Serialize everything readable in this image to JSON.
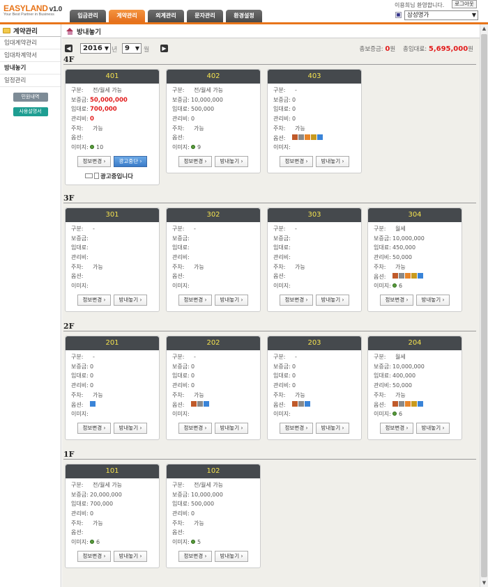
{
  "app": {
    "logo": "EASYLAND",
    "version": "v1.0",
    "tagline": "Your Best Partner in Business"
  },
  "nav": {
    "tabs": [
      {
        "label": "입금관리",
        "active": false
      },
      {
        "label": "계약관리",
        "active": true
      },
      {
        "label": "외계관리",
        "active": false
      },
      {
        "label": "문자관리",
        "active": false
      },
      {
        "label": "환경설정",
        "active": false
      }
    ]
  },
  "user": {
    "welcome": "이용희님 환영합니다.",
    "logout_label": "로그아웃",
    "company": "삼성명가"
  },
  "sidebar": {
    "title": "계약관리",
    "items": [
      {
        "label": "임대계약관리",
        "active": false
      },
      {
        "label": "임대차계약서",
        "active": false
      },
      {
        "label": "방내놓기",
        "active": true
      },
      {
        "label": "일정관리",
        "active": false
      }
    ],
    "buttons": [
      {
        "label": "민원내역",
        "color": "#7d8b96"
      },
      {
        "label": "사용설명서",
        "color": "#1e9e92"
      }
    ]
  },
  "page": {
    "title": "방내놓기",
    "year": "2016",
    "year_unit": "년",
    "month": "9",
    "month_unit": "월",
    "totals": {
      "deposit_label": "총보증금:",
      "deposit_value": "0",
      "deposit_unit": "원",
      "rent_label": "총임대료:",
      "rent_value": "5,695,000",
      "rent_unit": "원"
    }
  },
  "labels": {
    "type": "구분:",
    "deposit": "보증금:",
    "rent": "임대료:",
    "fee": "관리비:",
    "parking": "주차:",
    "options": "옵션:",
    "images": "이미지:",
    "edit_button": "정보변경",
    "list_button": "방내놓기",
    "ad_stop_button": "광고중단",
    "ad_status": "광고중입니다"
  },
  "floors": [
    {
      "label": "4F",
      "rooms": [
        {
          "number": "401",
          "type": "전/월세 가능",
          "deposit": "50,000,000",
          "rent": "700,000",
          "fee": "0",
          "parking": "가능",
          "options": "",
          "option_icons": [],
          "images": "10",
          "highlight": true,
          "advertised": true
        },
        {
          "number": "402",
          "type": "전/월세 가능",
          "deposit": "10,000,000",
          "rent": "500,000",
          "fee": "0",
          "parking": "가능",
          "options": "",
          "option_icons": [],
          "images": "9",
          "highlight": false,
          "advertised": false
        },
        {
          "number": "403",
          "type": "-",
          "deposit": "0",
          "rent": "0",
          "fee": "0",
          "parking": "가능",
          "options": "",
          "option_icons": [
            "a",
            "b",
            "c",
            "d",
            "e"
          ],
          "images": "",
          "highlight": false,
          "advertised": false
        }
      ]
    },
    {
      "label": "3F",
      "rooms": [
        {
          "number": "301",
          "type": "-",
          "deposit": "",
          "rent": "",
          "fee": "",
          "parking": "가능",
          "options": "",
          "option_icons": [],
          "images": "",
          "highlight": false,
          "advertised": false
        },
        {
          "number": "302",
          "type": "-",
          "deposit": "",
          "rent": "",
          "fee": "",
          "parking": "가능",
          "options": "",
          "option_icons": [],
          "images": "",
          "highlight": false,
          "advertised": false
        },
        {
          "number": "303",
          "type": "-",
          "deposit": "",
          "rent": "",
          "fee": "",
          "parking": "가능",
          "options": "",
          "option_icons": [],
          "images": "",
          "highlight": false,
          "advertised": false
        },
        {
          "number": "304",
          "type": "월세",
          "deposit": "10,000,000",
          "rent": "450,000",
          "fee": "50,000",
          "parking": "가능",
          "options": "",
          "option_icons": [
            "a",
            "b",
            "c",
            "d",
            "e"
          ],
          "images": "6",
          "highlight": false,
          "advertised": false
        }
      ]
    },
    {
      "label": "2F",
      "rooms": [
        {
          "number": "201",
          "type": "-",
          "deposit": "0",
          "rent": "0",
          "fee": "0",
          "parking": "가능",
          "options": "",
          "option_icons": [
            "e"
          ],
          "images": "",
          "highlight": false,
          "advertised": false
        },
        {
          "number": "202",
          "type": "-",
          "deposit": "0",
          "rent": "0",
          "fee": "0",
          "parking": "가능",
          "options": "",
          "option_icons": [
            "a",
            "b",
            "e"
          ],
          "images": "",
          "highlight": false,
          "advertised": false
        },
        {
          "number": "203",
          "type": "-",
          "deposit": "0",
          "rent": "0",
          "fee": "0",
          "parking": "가능",
          "options": "",
          "option_icons": [
            "a",
            "b",
            "e"
          ],
          "images": "",
          "highlight": false,
          "advertised": false
        },
        {
          "number": "204",
          "type": "월세",
          "deposit": "10,000,000",
          "rent": "400,000",
          "fee": "50,000",
          "parking": "가능",
          "options": "",
          "option_icons": [
            "a",
            "b",
            "c",
            "d",
            "e"
          ],
          "images": "6",
          "highlight": false,
          "advertised": false
        }
      ]
    },
    {
      "label": "1F",
      "rooms": [
        {
          "number": "101",
          "type": "전/월세 가능",
          "deposit": "20,000,000",
          "rent": "700,000",
          "fee": "0",
          "parking": "가능",
          "options": "",
          "option_icons": [],
          "images": "6",
          "highlight": false,
          "advertised": false
        },
        {
          "number": "102",
          "type": "전/월세 가능",
          "deposit": "10,000,000",
          "rent": "500,000",
          "fee": "0",
          "parking": "가능",
          "options": "",
          "option_icons": [],
          "images": "5",
          "highlight": false,
          "advertised": false
        }
      ]
    }
  ],
  "colors": {
    "accent": "#e8751a",
    "card_header": "#45494d",
    "card_header_text": "#f5e34f",
    "highlight_red": "#e21b1b",
    "background": "#f0efea"
  }
}
